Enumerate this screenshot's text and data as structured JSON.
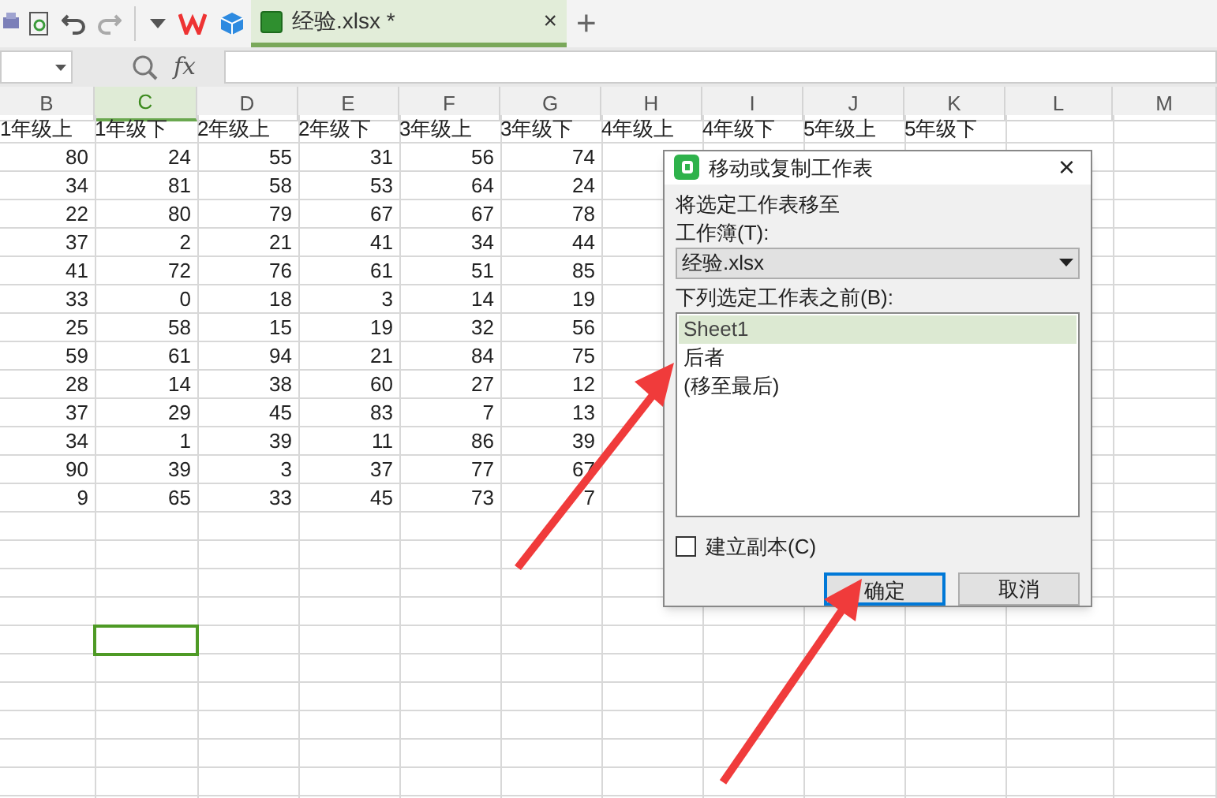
{
  "toolbar": {
    "tab": {
      "title": "经验.xlsx *",
      "close": "×",
      "selected": true
    },
    "new_tab": "+"
  },
  "formula_bar": {
    "fx": "fx"
  },
  "sheet": {
    "columns": [
      {
        "label": "B",
        "selected": false
      },
      {
        "label": "C",
        "selected": true
      },
      {
        "label": "D",
        "selected": false
      },
      {
        "label": "E",
        "selected": false
      },
      {
        "label": "F",
        "selected": false
      },
      {
        "label": "G",
        "selected": false
      },
      {
        "label": "H",
        "selected": false
      },
      {
        "label": "I",
        "selected": false
      },
      {
        "label": "J",
        "selected": false
      },
      {
        "label": "K",
        "selected": false
      },
      {
        "label": "L",
        "selected": false
      },
      {
        "label": "M",
        "selected": false
      }
    ],
    "header_row": [
      "1年级上",
      "1年级下",
      "2年级上",
      "2年级下",
      "3年级上",
      "3年级下",
      "4年级上",
      "4年级下",
      "5年级上",
      "5年级下"
    ],
    "rows": [
      [
        "80",
        "24",
        "55",
        "31",
        "56",
        "74"
      ],
      [
        "34",
        "81",
        "58",
        "53",
        "64",
        "24"
      ],
      [
        "22",
        "80",
        "79",
        "67",
        "67",
        "78"
      ],
      [
        "37",
        "2",
        "21",
        "41",
        "34",
        "44"
      ],
      [
        "41",
        "72",
        "76",
        "61",
        "51",
        "85"
      ],
      [
        "33",
        "0",
        "18",
        "3",
        "14",
        "19"
      ],
      [
        "25",
        "58",
        "15",
        "19",
        "32",
        "56"
      ],
      [
        "59",
        "61",
        "94",
        "21",
        "84",
        "75"
      ],
      [
        "28",
        "14",
        "38",
        "60",
        "27",
        "12"
      ],
      [
        "37",
        "29",
        "45",
        "83",
        "7",
        "13"
      ],
      [
        "34",
        "1",
        "39",
        "11",
        "86",
        "39"
      ],
      [
        "90",
        "39",
        "3",
        "37",
        "77",
        "67"
      ],
      [
        "9",
        "65",
        "33",
        "45",
        "73",
        "7"
      ]
    ]
  },
  "dialog": {
    "title": "移动或复制工作表",
    "close": "×",
    "move_label": "将选定工作表移至",
    "workbook_label": "工作簿(T):",
    "workbook_value": "经验.xlsx",
    "before_label": "下列选定工作表之前(B):",
    "sheets": [
      {
        "label": "Sheet1",
        "selected": true
      },
      {
        "label": "后者",
        "selected": false
      },
      {
        "label": "(移至最后)",
        "selected": false
      }
    ],
    "copy_checkbox": {
      "label": "建立副本(C)",
      "checked": false
    },
    "buttons": [
      {
        "label": "确定",
        "focused": true
      },
      {
        "label": "取消",
        "focused": false
      }
    ]
  }
}
